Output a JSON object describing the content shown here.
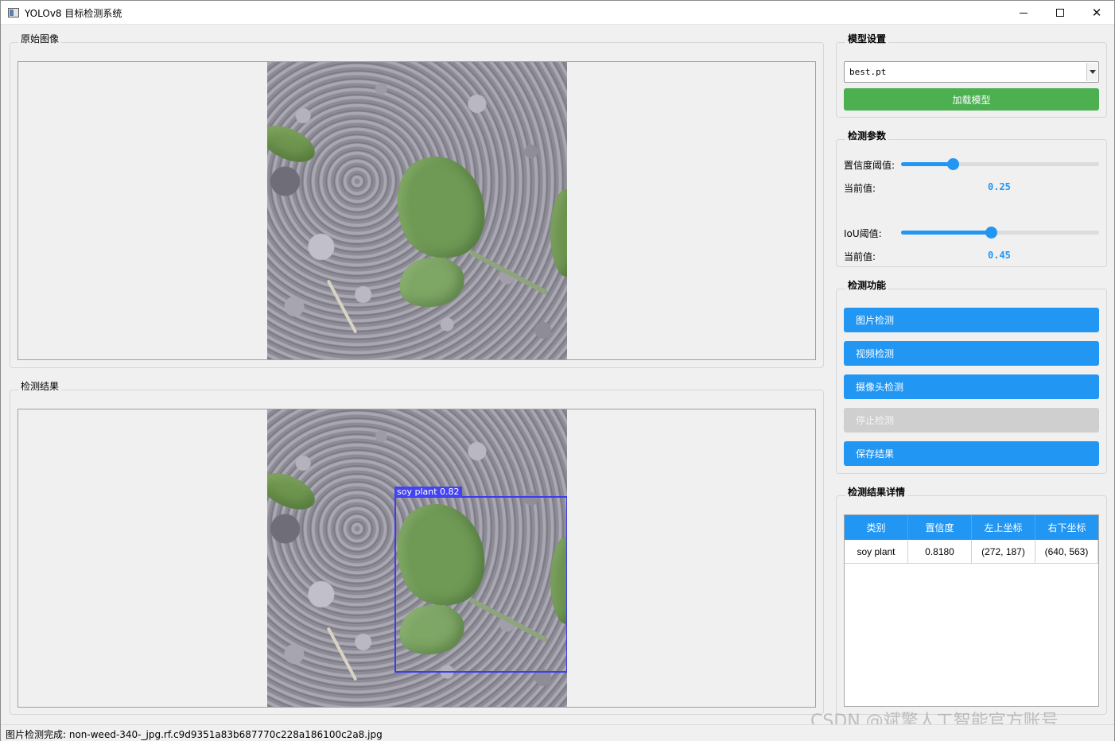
{
  "window": {
    "title": "YOLOv8 目标检测系统"
  },
  "original_panel": {
    "title": "原始图像"
  },
  "result_panel": {
    "title": "检测结果",
    "detection_label": "soy plant 0.82"
  },
  "model_settings": {
    "title": "模型设置",
    "model_selected": "best.pt",
    "load_button": "加载模型"
  },
  "detect_params": {
    "title": "检测参数",
    "confidence_label": "置信度阈值:",
    "confidence_current_label": "当前值:",
    "confidence_value": "0.25",
    "iou_label": "IoU阈值:",
    "iou_current_label": "当前值:",
    "iou_value": "0.45"
  },
  "detect_functions": {
    "title": "检测功能",
    "image_detect": "图片检测",
    "video_detect": "视频检测",
    "camera_detect": "摄像头检测",
    "stop_detect": "停止检测",
    "save_result": "保存结果"
  },
  "result_details": {
    "title": "检测结果详情",
    "columns": [
      "类别",
      "置信度",
      "左上坐标",
      "右下坐标"
    ],
    "rows": [
      [
        "soy plant",
        "0.8180",
        "(272, 187)",
        "(640, 563)"
      ]
    ]
  },
  "status": {
    "text": "图片检测完成: non-weed-340-_jpg.rf.c9d9351a83b687770c228a186100c2a8.jpg"
  },
  "watermark": "CSDN @斌擎人工智能官方账号",
  "colors": {
    "accent_blue": "#2196f3",
    "accent_green": "#4caf50",
    "bbox": "#3c3cf0",
    "disabled": "#cfcfcf"
  }
}
